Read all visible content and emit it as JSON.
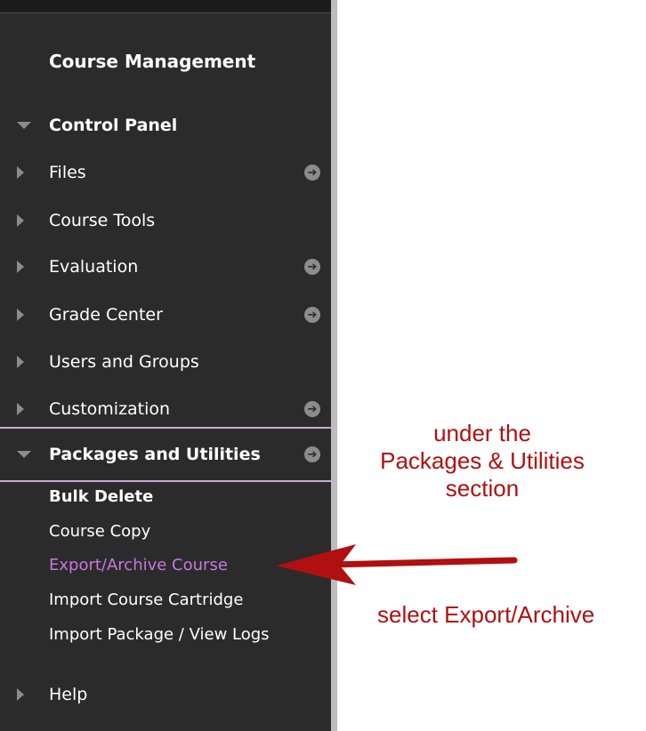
{
  "sidebar": {
    "heading": "Course Management",
    "control_panel": "Control Panel",
    "items": [
      {
        "label": "Files",
        "has_arrow": true
      },
      {
        "label": "Course Tools",
        "has_arrow": false
      },
      {
        "label": "Evaluation",
        "has_arrow": true
      },
      {
        "label": "Grade Center",
        "has_arrow": true
      },
      {
        "label": "Users and Groups",
        "has_arrow": false
      },
      {
        "label": "Customization",
        "has_arrow": true
      }
    ],
    "packages": {
      "label": "Packages and Utilities",
      "subitems": [
        {
          "label": "Bulk Delete"
        },
        {
          "label": "Course Copy"
        },
        {
          "label": "Export/Archive Course",
          "active": true
        },
        {
          "label": "Import Course Cartridge"
        },
        {
          "label": "Import Package / View Logs"
        }
      ]
    },
    "help": "Help"
  },
  "annotations": {
    "section_line1": "under the",
    "section_line2": "Packages & Utilities",
    "section_line3": "section",
    "select": "select Export/Archive"
  },
  "colors": {
    "sidebar_bg": "#2b2b2b",
    "active_link": "#c678e0",
    "annotation": "#b01010",
    "section_divider": "#c9a9d9"
  }
}
